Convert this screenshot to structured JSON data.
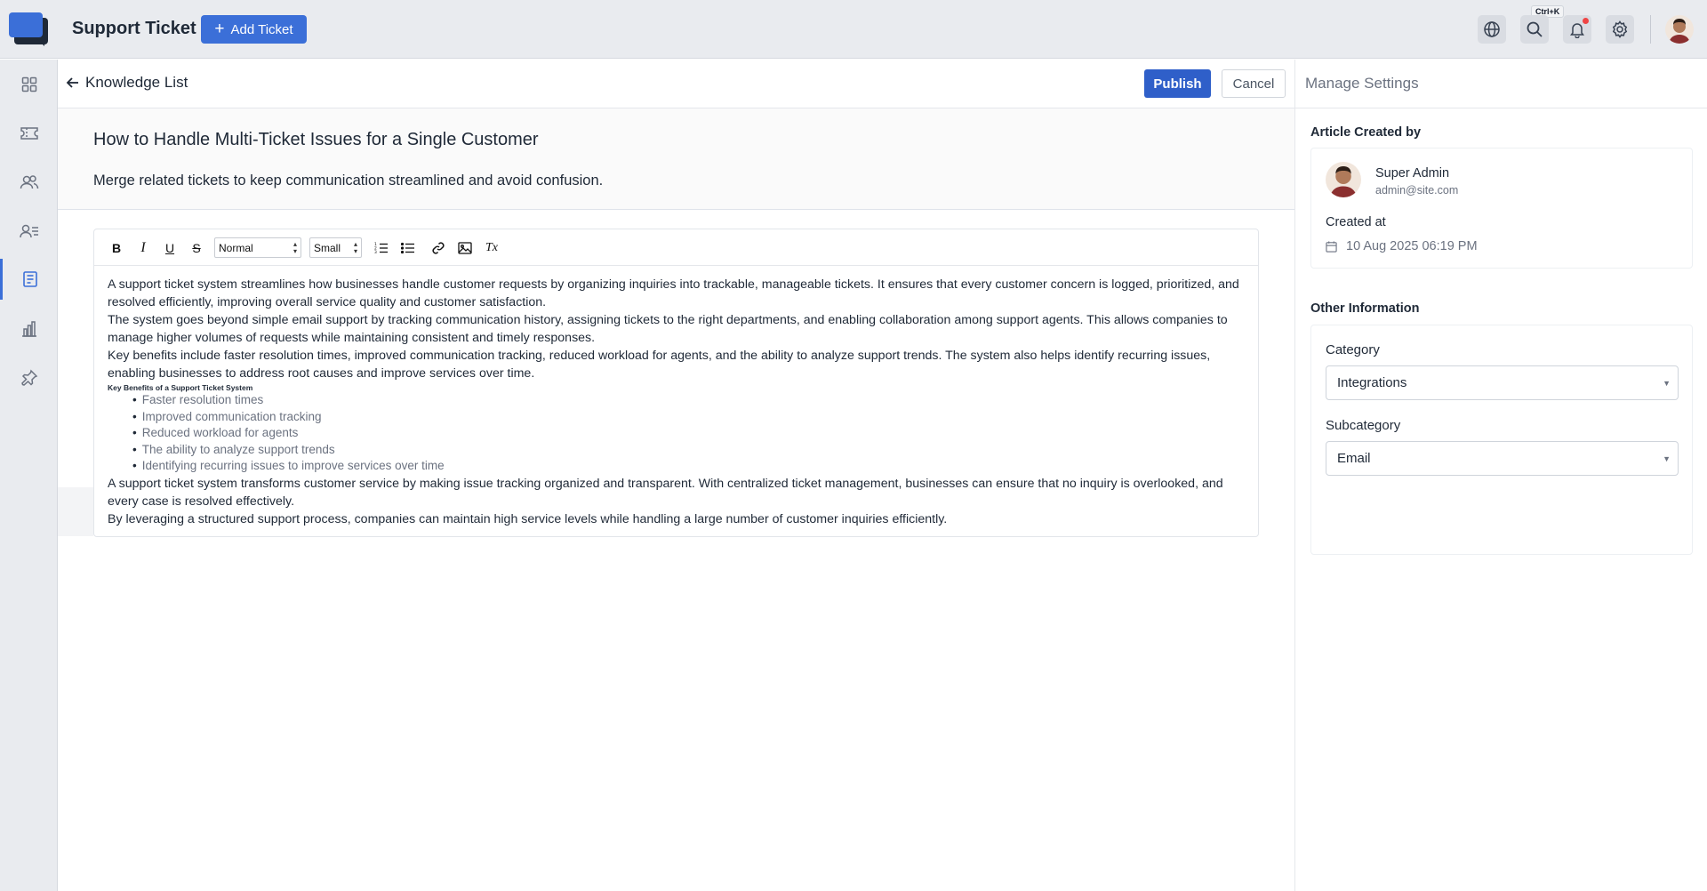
{
  "app": {
    "title": "Support Ticket",
    "add_ticket_label": "Add Ticket",
    "search_shortcut": "Ctrl+K"
  },
  "header": {
    "back_label": "Knowledge List",
    "publish_label": "Publish",
    "cancel_label": "Cancel"
  },
  "article": {
    "title": "How to Handle Multi-Ticket Issues for a Single Customer",
    "summary": "Merge related tickets to keep communication streamlined and avoid confusion."
  },
  "toolbar": {
    "bold": "B",
    "italic": "I",
    "underline": "U",
    "strike": "S",
    "heading_select": "Normal",
    "size_select": "Small",
    "clear_format": "Tx"
  },
  "content": {
    "p1": "A support ticket system streamlines how businesses handle customer requests by organizing inquiries into trackable, manageable tickets. It ensures that every customer concern is logged, prioritized, and resolved efficiently, improving overall service quality and customer satisfaction.",
    "p2": "The system goes beyond simple email support by tracking communication history, assigning tickets to the right departments, and enabling collaboration among support agents. This allows companies to manage higher volumes of requests while maintaining consistent and timely responses.",
    "p3": "Key benefits include faster resolution times, improved communication tracking, reduced workload for agents, and the ability to analyze support trends. The system also helps identify recurring issues, enabling businesses to address root causes and improve services over time.",
    "list_heading": "Key Benefits of a Support Ticket System",
    "list": [
      "Faster resolution times",
      "Improved communication tracking",
      "Reduced workload for agents",
      "The ability to analyze support trends",
      "Identifying recurring issues to improve services over time"
    ],
    "p4": "A support ticket system transforms customer service by making issue tracking organized and transparent. With centralized ticket management, businesses can ensure that no inquiry is overlooked, and every case is resolved effectively.",
    "p5": "By leveraging a structured support process, companies can maintain high service levels while handling a large number of customer inquiries efficiently."
  },
  "settings": {
    "title": "Manage Settings",
    "created_by_label": "Article Created by",
    "creator_name": "Super Admin",
    "creator_email": "admin@site.com",
    "created_at_label": "Created at",
    "created_at_value": "10 Aug 2025 06:19 PM",
    "other_info_label": "Other Information",
    "category_label": "Category",
    "category_value": "Integrations",
    "subcategory_label": "Subcategory",
    "subcategory_value": "Email"
  },
  "colors": {
    "accent": "#3b6fd8",
    "publish": "#2f5fc9",
    "notification": "#ef4444"
  },
  "icons": {
    "sidebar": [
      "dashboard-icon",
      "ticket-icon",
      "users-icon",
      "contacts-icon",
      "knowledge-icon",
      "reports-icon",
      "pin-icon"
    ],
    "topbar": [
      "globe-icon",
      "search-icon",
      "bell-icon",
      "gear-icon"
    ]
  }
}
